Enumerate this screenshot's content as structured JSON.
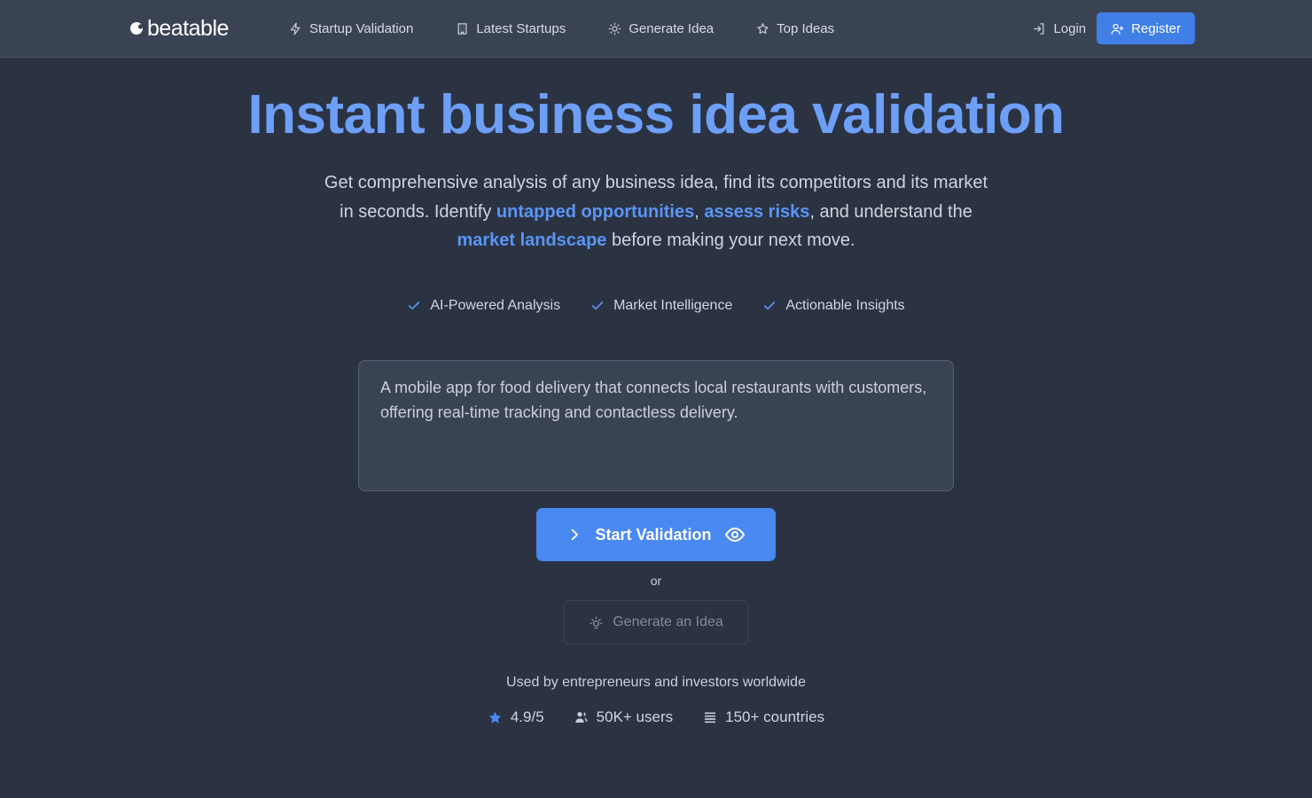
{
  "brand": {
    "name": "beatable"
  },
  "nav": {
    "items": [
      {
        "label": "Startup Validation",
        "icon": "bolt-icon"
      },
      {
        "label": "Latest Startups",
        "icon": "building-icon"
      },
      {
        "label": "Generate Idea",
        "icon": "lightbulb-icon"
      },
      {
        "label": "Top Ideas",
        "icon": "star-outline-icon"
      }
    ],
    "login_label": "Login",
    "register_label": "Register"
  },
  "hero": {
    "title": "Instant business idea validation",
    "subtitle": {
      "part1": "Get comprehensive analysis of any business idea, find its competitors and its market in seconds. Identify ",
      "highlight1": "untapped opportunities",
      "part2": ", ",
      "highlight2": "assess risks",
      "part3": ", and understand the ",
      "highlight3": "market landscape",
      "part4": " before making your next move."
    },
    "features": [
      "AI-Powered Analysis",
      "Market Intelligence",
      "Actionable Insights"
    ]
  },
  "form": {
    "idea_placeholder": "A mobile app for food delivery that connects local restaurants with customers, offering real-time tracking and contactless delivery.",
    "start_label": "Start Validation",
    "or_label": "or",
    "generate_label": "Generate an Idea"
  },
  "social_proof": {
    "caption": "Used by entrepreneurs and investors worldwide",
    "rating": "4.9/5",
    "users": "50K+ users",
    "countries": "150+ countries"
  },
  "colors": {
    "background": "#2b3343",
    "navbar": "#3a4354",
    "accent": "#4a88f2",
    "headline": "#6d9ff7",
    "highlight": "#5a95f5"
  }
}
